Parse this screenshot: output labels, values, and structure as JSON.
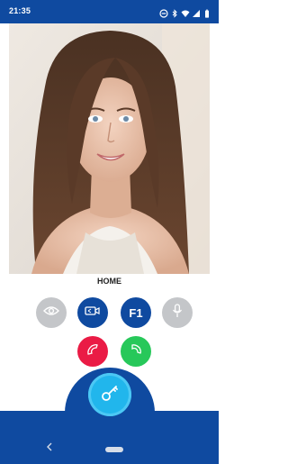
{
  "status_bar": {
    "time": "21:35",
    "icons": [
      "do-not-disturb-icon",
      "bluetooth-icon",
      "wifi-icon",
      "signal-icon",
      "battery-icon"
    ]
  },
  "video": {
    "description_icon": "video-feed"
  },
  "caller": {
    "label": "HOME"
  },
  "controls": {
    "row1": [
      {
        "id": "eye",
        "icon": "eye-icon",
        "color": "#c4c6c9"
      },
      {
        "id": "camera-switch",
        "icon": "camera-switch-icon",
        "color": "#0f4aa0"
      },
      {
        "id": "function",
        "text": "F1",
        "color": "#0f4aa0"
      },
      {
        "id": "microphone",
        "icon": "microphone-icon",
        "color": "#c4c6c9"
      }
    ],
    "row2": [
      {
        "id": "hang-up",
        "icon": "hang-up-icon",
        "color": "#ea1b45"
      },
      {
        "id": "answer",
        "icon": "answer-call-icon",
        "color": "#27c85a"
      }
    ],
    "main_key_icon": "key-icon"
  },
  "nav": {
    "back_icon": "back-icon",
    "home_icon": "home-pill-icon"
  },
  "colors": {
    "brand": "#0f4aa0",
    "accent": "#21b6ec"
  }
}
